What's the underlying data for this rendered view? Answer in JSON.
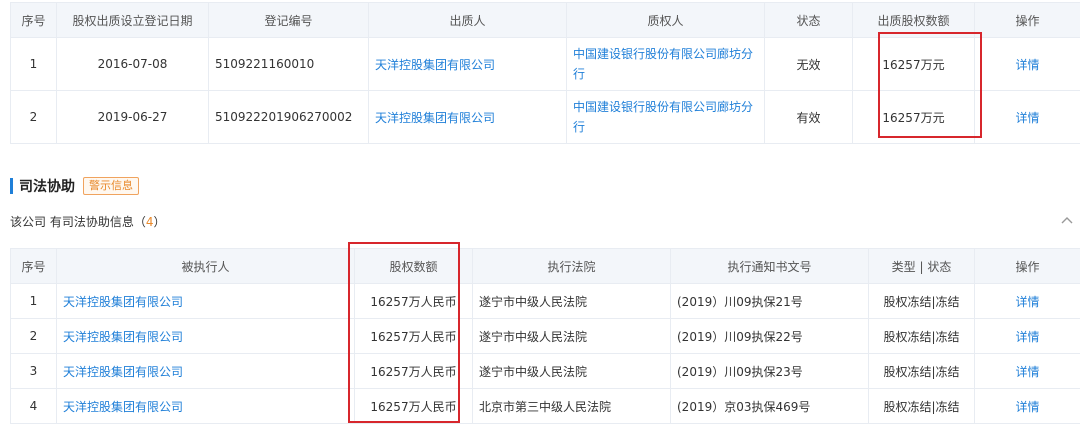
{
  "table1": {
    "headers": [
      "序号",
      "股权出质设立登记日期",
      "登记编号",
      "出质人",
      "质权人",
      "状态",
      "出质股权数额",
      "操作"
    ],
    "rows": [
      {
        "no": "1",
        "date": "2016-07-08",
        "reg": "5109221160010",
        "pledgor": "天洋控股集团有限公司",
        "pledgee": "中国建设银行股份有限公司廊坊分行",
        "status": "无效",
        "amount": "16257万元",
        "action": "详情"
      },
      {
        "no": "2",
        "date": "2019-06-27",
        "reg": "510922201906270002",
        "pledgor": "天洋控股集团有限公司",
        "pledgee": "中国建设银行股份有限公司廊坊分行",
        "status": "有效",
        "amount": "16257万元",
        "action": "详情"
      }
    ]
  },
  "section": {
    "title": "司法协助",
    "badge": "警示信息",
    "summary_prefix": "该公司 有司法协助信息（",
    "summary_count": "4",
    "summary_suffix": "）"
  },
  "table2": {
    "headers": [
      "序号",
      "被执行人",
      "股权数额",
      "执行法院",
      "执行通知书文号",
      "类型 | 状态",
      "操作"
    ],
    "rows": [
      {
        "no": "1",
        "party": "天洋控股集团有限公司",
        "amount": "16257万人民币",
        "court": "遂宁市中级人民法院",
        "doc": "(2019）川09执保21号",
        "type": "股权冻结|冻结",
        "action": "详情"
      },
      {
        "no": "2",
        "party": "天洋控股集团有限公司",
        "amount": "16257万人民币",
        "court": "遂宁市中级人民法院",
        "doc": "(2019）川09执保22号",
        "type": "股权冻结|冻结",
        "action": "详情"
      },
      {
        "no": "3",
        "party": "天洋控股集团有限公司",
        "amount": "16257万人民币",
        "court": "遂宁市中级人民法院",
        "doc": "(2019）川09执保23号",
        "type": "股权冻结|冻结",
        "action": "详情"
      },
      {
        "no": "4",
        "party": "天洋控股集团有限公司",
        "amount": "16257万人民币",
        "court": "北京市第三中级人民法院",
        "doc": "(2019）京03执保469号",
        "type": "股权冻结|冻结",
        "action": "详情"
      }
    ]
  },
  "colors": {
    "link": "#1f7fd8",
    "highlight": "#d7262c",
    "accent": "#e8892b"
  }
}
